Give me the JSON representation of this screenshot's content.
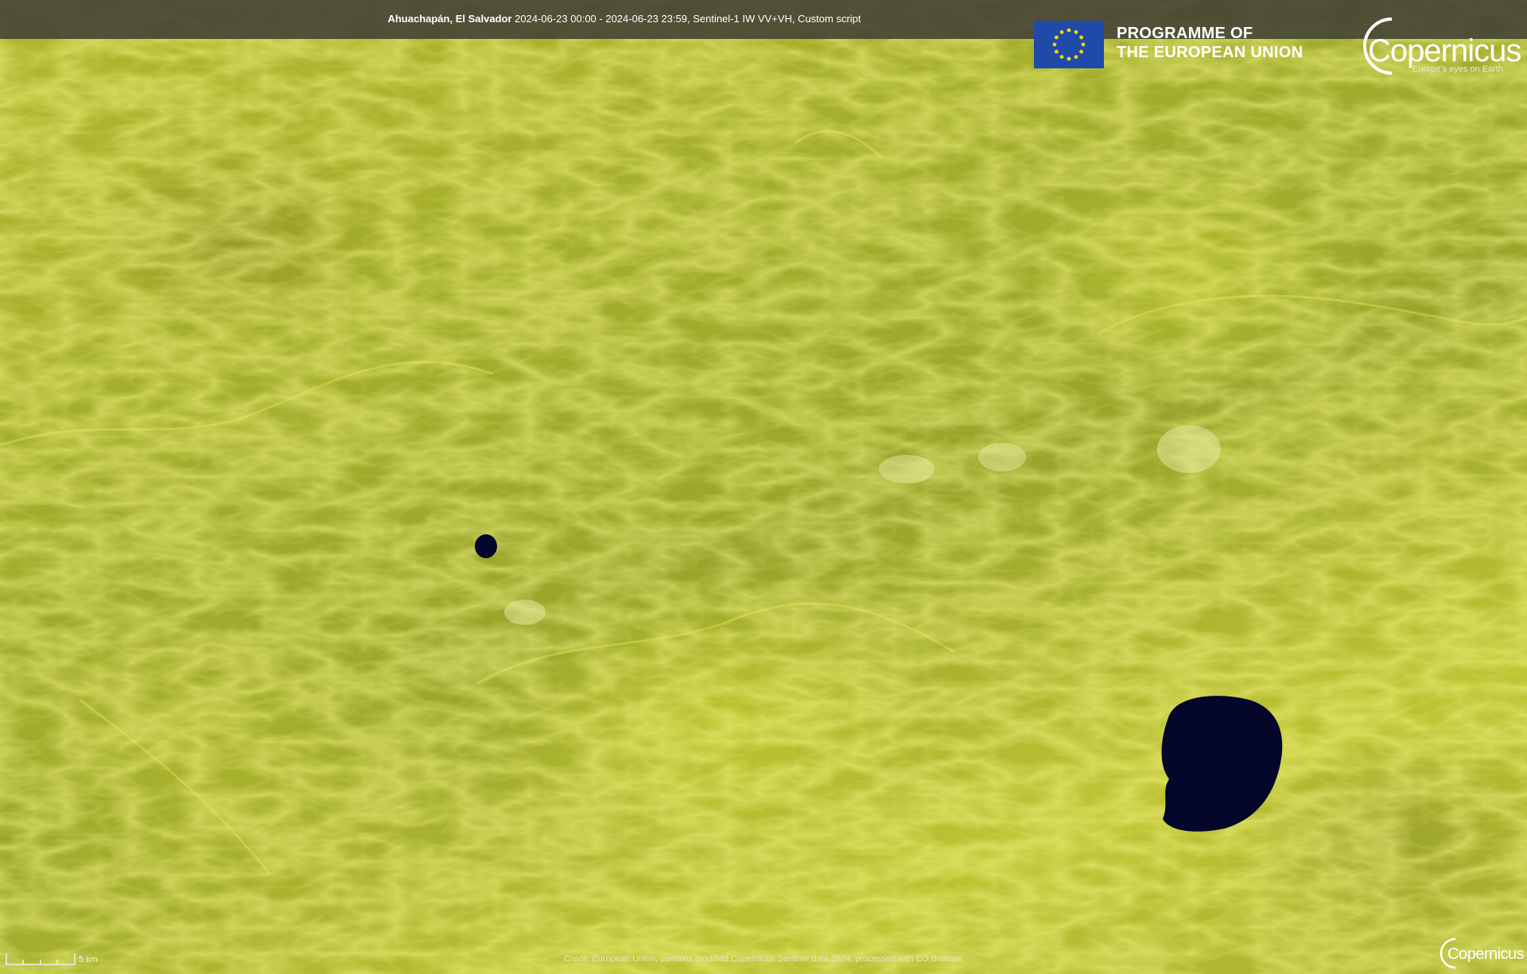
{
  "header": {
    "place": "Ahuachapán, El Salvador",
    "details": "2024-06-23 00:00 - 2024-06-23 23:59, Sentinel-1 IW VV+VH, Custom script"
  },
  "branding": {
    "programme_line1": "PROGRAMME OF",
    "programme_line2": "THE EUROPEAN UNION",
    "copernicus_word": "Copernicus",
    "copernicus_tagline": "Europe's eyes on Earth",
    "small_logo_word": "Copernicus"
  },
  "footer": {
    "credit": "Credit: European Union, contains modified Copernicus Sentinel data 2024, processed with EO Browser",
    "scale_label": "5 km"
  },
  "colors": {
    "eu_blue": "#1f4aa8",
    "eu_star": "#f4d21a",
    "water": "#05072a",
    "terrain_bright": "#e4ec3a",
    "terrain_dark": "#6f7a1c"
  },
  "icons": {
    "eu_flag": "eu-flag-icon",
    "copernicus_logo": "copernicus-logo-icon",
    "scale_bar": "scale-bar-icon"
  }
}
